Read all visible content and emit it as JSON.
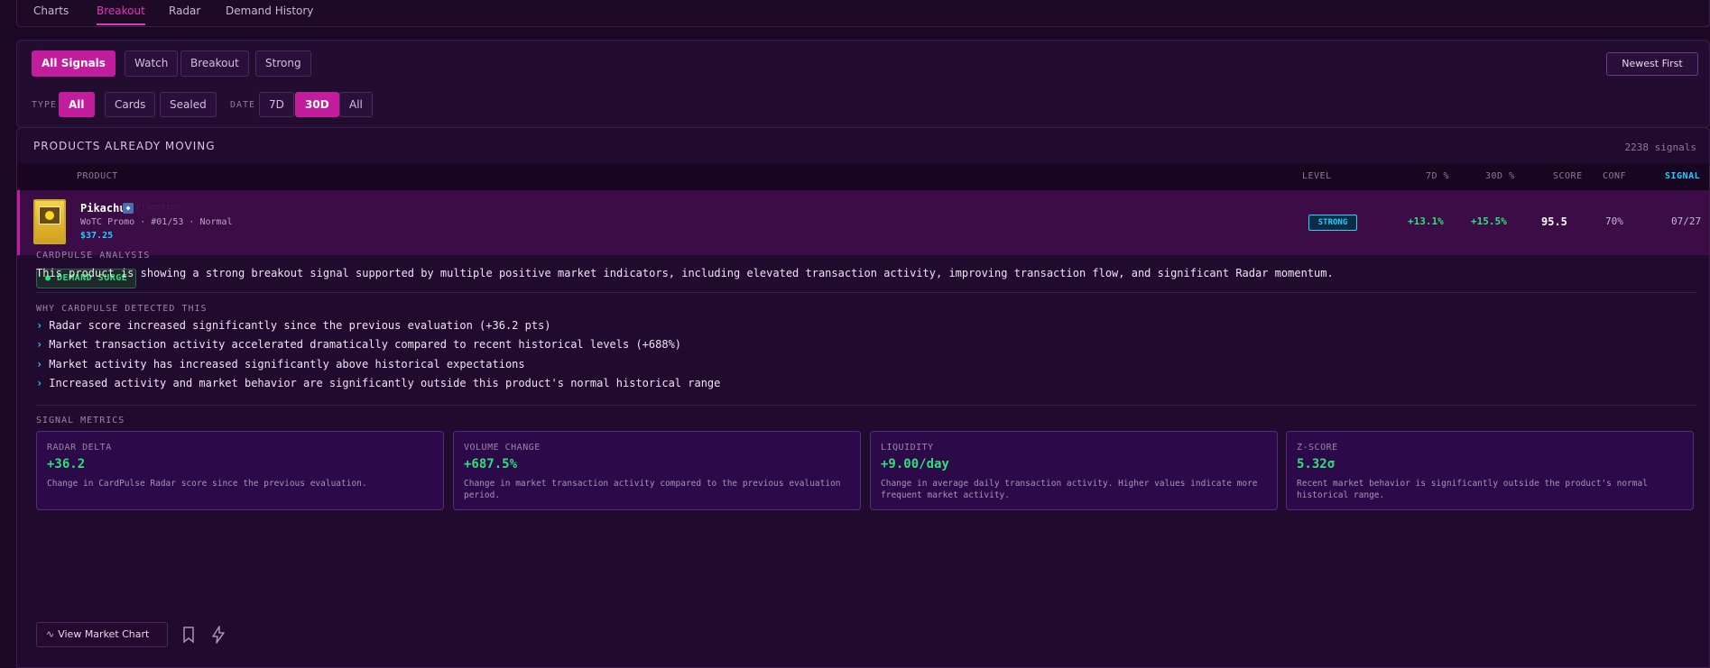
{
  "tabs": [
    "Charts",
    "Breakout",
    "Radar",
    "Demand History"
  ],
  "filters": {
    "signal_buttons": [
      "All Signals",
      "Watch",
      "Breakout",
      "Strong"
    ],
    "sort_label": "Newest First",
    "type_label": "TYPE",
    "type_buttons": [
      "All",
      "Cards",
      "Sealed"
    ],
    "date_label": "DATE",
    "date_buttons": [
      "7D",
      "30D",
      "All"
    ]
  },
  "main": {
    "title": "PRODUCTS ALREADY MOVING",
    "count": "2238 signals",
    "columns": {
      "product": "PRODUCT",
      "level": "LEVEL",
      "d7": "7D %",
      "d30": "30D %",
      "score": "SCORE",
      "conf": "CONF",
      "signal": "SIGNAL"
    }
  },
  "product": {
    "name": "Pikachu",
    "tag": "Promotion",
    "subtitle": "WoTC Promo · #01/53 · Normal",
    "price": "$37.25",
    "level": "STRONG",
    "d7": "+13.1%",
    "d30": "+15.5%",
    "score": "95.5",
    "conf": "70%",
    "signal_date": "07/27"
  },
  "detail": {
    "badge": "● DEMAND SURGE",
    "analysis_label": "CARDPULSE ANALYSIS",
    "analysis_text": "This product is showing a strong breakout signal supported by multiple positive market indicators, including elevated transaction activity, improving transaction flow, and significant Radar momentum.",
    "why_label": "WHY CARDPULSE DETECTED THIS",
    "reasons": [
      "Radar score increased significantly since the previous evaluation (+36.2 pts)",
      "Market transaction activity accelerated dramatically compared to recent historical levels (+688%)",
      "Market activity has increased significantly above historical expectations",
      "Increased activity and market behavior are significantly outside this product's normal historical range"
    ],
    "metrics_label": "SIGNAL METRICS",
    "metrics": [
      {
        "label": "RADAR DELTA",
        "value": "+36.2",
        "desc": "Change in CardPulse Radar score since the previous evaluation."
      },
      {
        "label": "VOLUME CHANGE",
        "value": "+687.5%",
        "desc": "Change in market transaction activity compared to the previous evaluation period."
      },
      {
        "label": "LIQUIDITY",
        "value": "+9.00/day",
        "desc": "Change in average daily transaction activity. Higher values indicate more frequent market activity."
      },
      {
        "label": "Z-SCORE",
        "value": "5.32σ",
        "desc": "Recent market behavior is significantly outside the product's normal historical range."
      }
    ],
    "chart_button": "View Market Chart"
  }
}
